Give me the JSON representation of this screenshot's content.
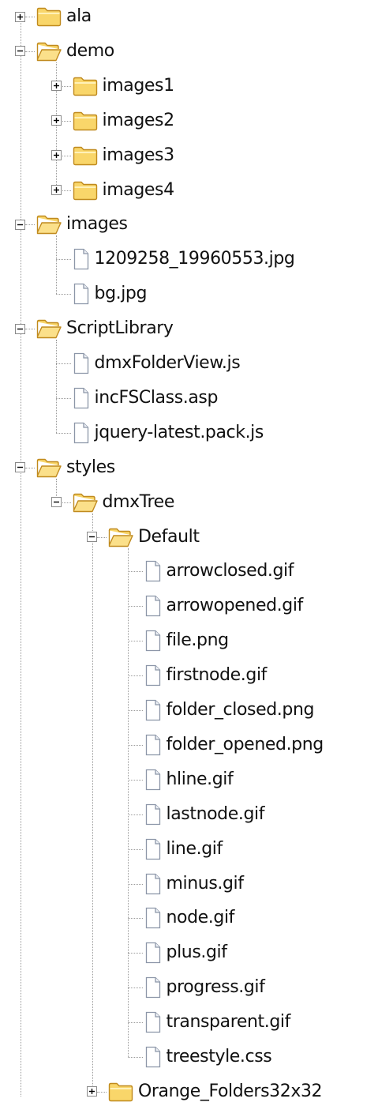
{
  "tree": [
    {
      "label": "ala",
      "type": "folder",
      "expanded": false
    },
    {
      "label": "demo",
      "type": "folder",
      "expanded": true,
      "children": [
        {
          "label": "images1",
          "type": "folder",
          "expanded": false
        },
        {
          "label": "images2",
          "type": "folder",
          "expanded": false
        },
        {
          "label": "images3",
          "type": "folder",
          "expanded": false
        },
        {
          "label": "images4",
          "type": "folder",
          "expanded": false
        }
      ]
    },
    {
      "label": "images",
      "type": "folder",
      "expanded": true,
      "children": [
        {
          "label": "1209258_19960553.jpg",
          "type": "file"
        },
        {
          "label": "bg.jpg",
          "type": "file"
        }
      ]
    },
    {
      "label": "ScriptLibrary",
      "type": "folder",
      "expanded": true,
      "children": [
        {
          "label": "dmxFolderView.js",
          "type": "file"
        },
        {
          "label": "incFSClass.asp",
          "type": "file"
        },
        {
          "label": "jquery-latest.pack.js",
          "type": "file"
        }
      ]
    },
    {
      "label": "styles",
      "type": "folder",
      "expanded": true,
      "children": [
        {
          "label": "dmxTree",
          "type": "folder",
          "expanded": true,
          "children": [
            {
              "label": "Default",
              "type": "folder",
              "expanded": true,
              "children": [
                {
                  "label": "arrowclosed.gif",
                  "type": "file"
                },
                {
                  "label": "arrowopened.gif",
                  "type": "file"
                },
                {
                  "label": "file.png",
                  "type": "file"
                },
                {
                  "label": "firstnode.gif",
                  "type": "file"
                },
                {
                  "label": "folder_closed.png",
                  "type": "file"
                },
                {
                  "label": "folder_opened.png",
                  "type": "file"
                },
                {
                  "label": "hline.gif",
                  "type": "file"
                },
                {
                  "label": "lastnode.gif",
                  "type": "file"
                },
                {
                  "label": "line.gif",
                  "type": "file"
                },
                {
                  "label": "minus.gif",
                  "type": "file"
                },
                {
                  "label": "node.gif",
                  "type": "file"
                },
                {
                  "label": "plus.gif",
                  "type": "file"
                },
                {
                  "label": "progress.gif",
                  "type": "file"
                },
                {
                  "label": "transparent.gif",
                  "type": "file"
                },
                {
                  "label": "treestyle.css",
                  "type": "file"
                }
              ]
            },
            {
              "label": "Orange_Folders32x32",
              "type": "folder",
              "expanded": false
            }
          ]
        }
      ]
    }
  ],
  "colors": {
    "line": "#9a9a9a",
    "folder_fill": "#f9d66a",
    "folder_stroke": "#c08a1e",
    "file_fill": "#ffffff",
    "file_stroke": "#8c96a8",
    "expander_stroke": "#8a8a8a"
  },
  "icons": {
    "closed_folder": "folder-closed-icon",
    "open_folder": "folder-open-icon",
    "file": "file-icon",
    "expand": "plus-expander-icon",
    "collapse": "minus-expander-icon"
  }
}
